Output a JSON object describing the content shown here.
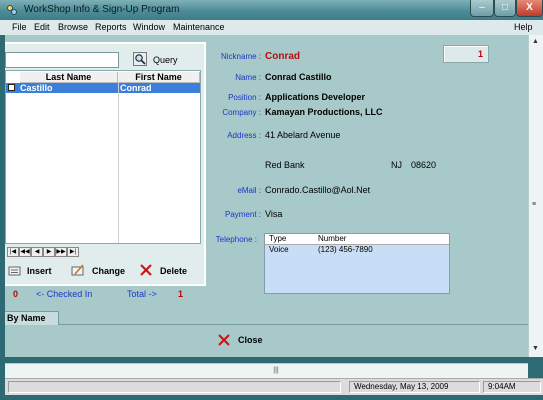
{
  "window": {
    "title": "WorkShop Info & Sign-Up Program",
    "min_glyph": "–",
    "max_glyph": "□",
    "close_glyph": "X"
  },
  "menu": [
    "File",
    "Edit",
    "Browse",
    "Reports",
    "Window",
    "Maintenance"
  ],
  "menu_help": "Help",
  "search": {
    "value": "",
    "query_label": "Query"
  },
  "grid": {
    "columns": [
      "Last Name",
      "First Name"
    ],
    "rows": [
      {
        "last": "Castillo",
        "first": "Conrad",
        "checked": false
      }
    ]
  },
  "navigator": [
    "|◀",
    "◀◀",
    "◀",
    "▶",
    "▶▶",
    "▶|"
  ],
  "actions": {
    "insert": "Insert",
    "change": "Change",
    "delete": "Delete"
  },
  "counts": {
    "checked_count": "0",
    "checked_label": "<- Checked In",
    "total_label": "Total ->",
    "total_count": "1"
  },
  "tab_label": "By Name",
  "record": {
    "id": "1",
    "labels": {
      "nickname": "Nickname :",
      "name": "Name :",
      "position": "Position :",
      "company": "Company :",
      "address": "Address :",
      "email": "eMail :",
      "payment": "Payment :",
      "telephone": "Telephone :"
    },
    "nickname": "Conrad",
    "name": "Conrad Castillo",
    "position": "Applications Developer",
    "company": "Kamayan Productions, LLC",
    "address_line1": "41 Abelard Avenue",
    "city": "Red Bank",
    "state": "NJ",
    "zip": "08620",
    "email": "Conrado.Castillo@Aol.Net",
    "payment": "Visa",
    "phone_columns": [
      "Type",
      "Number"
    ],
    "phones": [
      {
        "type": "Voice",
        "number": "(123) 456-7890"
      }
    ]
  },
  "close_label": "Close",
  "status": {
    "date": "Wednesday, May 13, 2009",
    "time": "9:04AM"
  }
}
